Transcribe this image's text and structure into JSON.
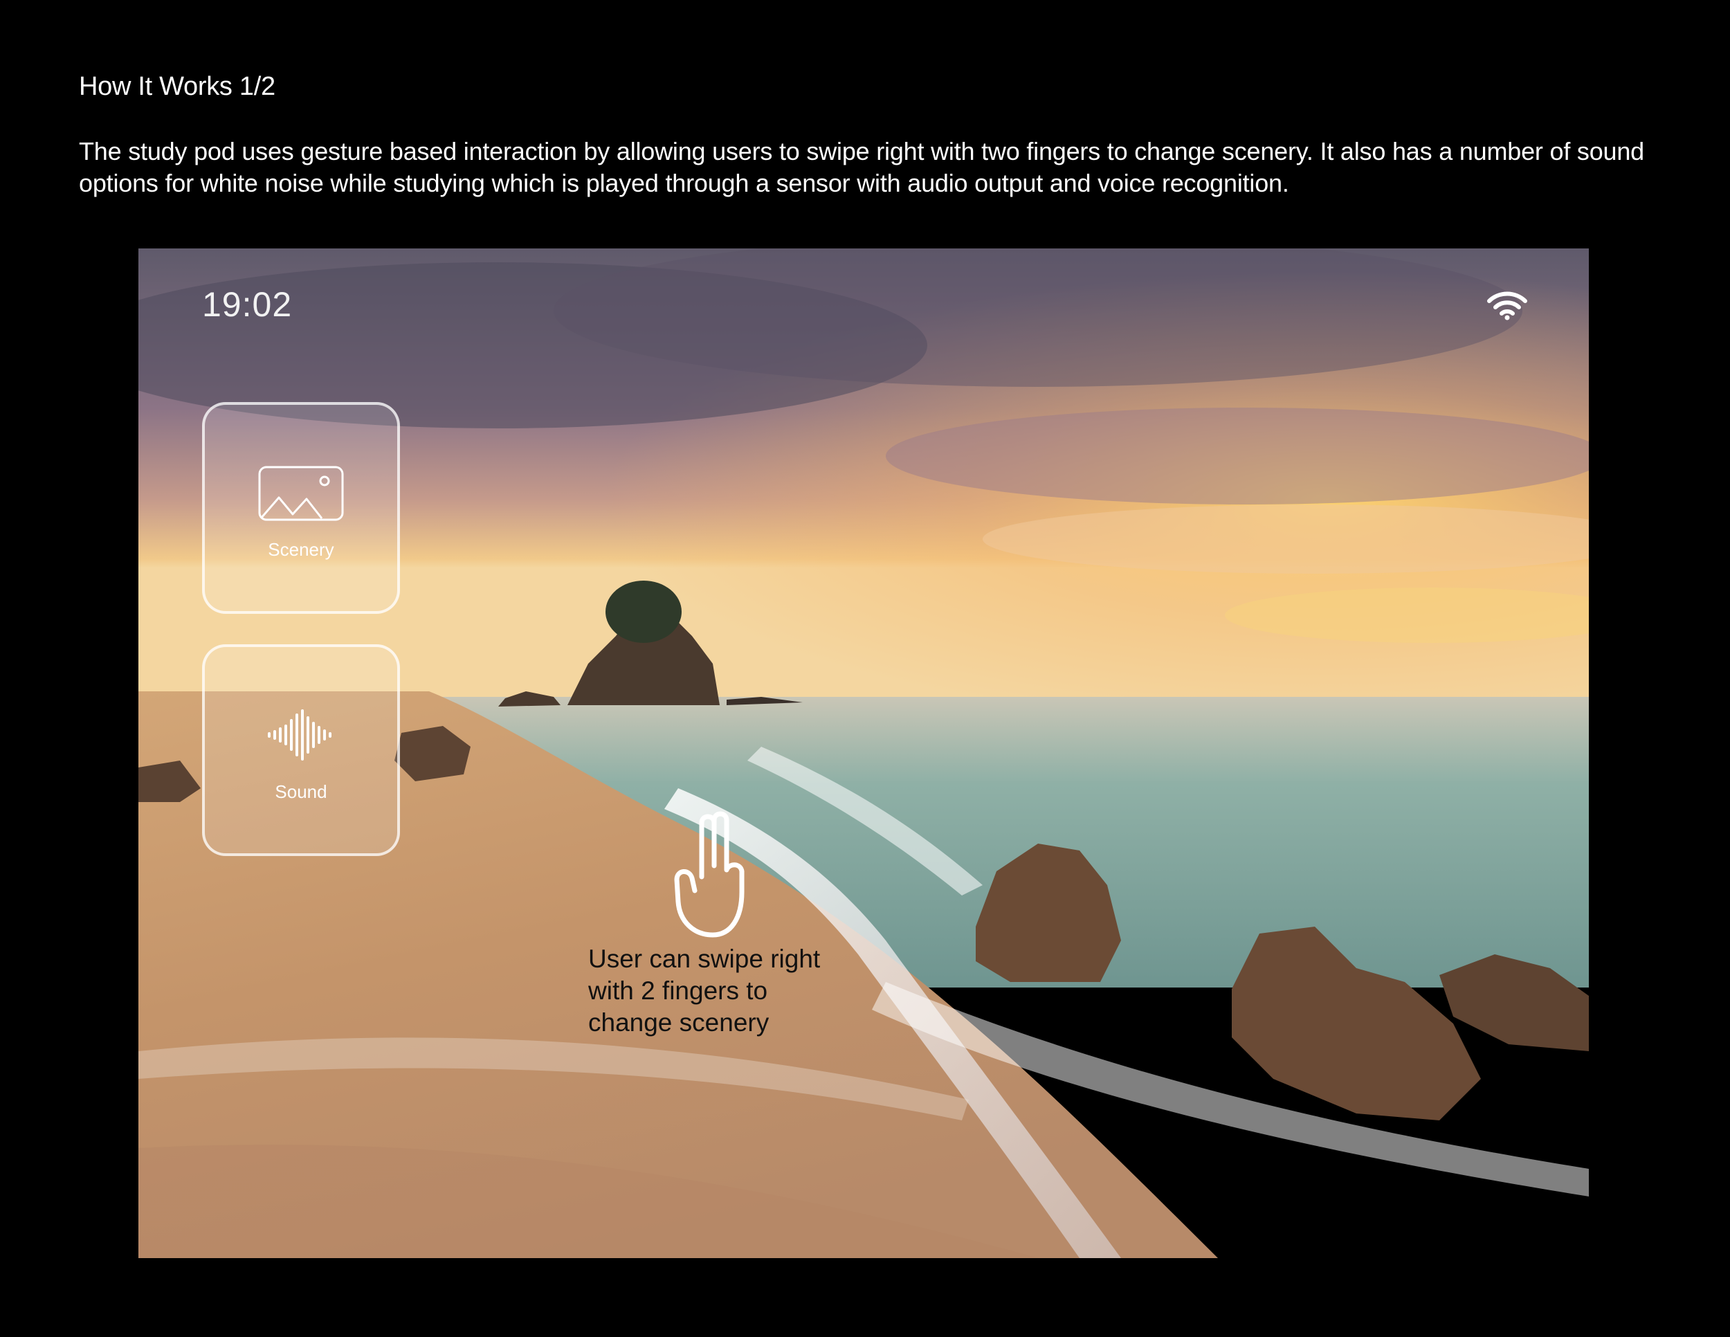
{
  "header": {
    "title": "How It Works 1/2",
    "description": "The study pod uses gesture based interaction by allowing users to swipe right with two fingers to change scenery. It also has a number of sound options for white noise while studying which is played through a sensor with audio output and voice recognition."
  },
  "screen": {
    "time": "19:02",
    "status_icons": [
      "wifi-icon"
    ],
    "tiles": [
      {
        "label": "Scenery",
        "icon": "image-icon"
      },
      {
        "label": "Sound",
        "icon": "sound-wave-icon"
      }
    ],
    "gesture": {
      "icon": "two-finger-hand-icon",
      "lines": [
        "User can swipe right",
        "with 2 fingers to",
        "change scenery"
      ]
    }
  },
  "colors": {
    "page_background": "#000000",
    "text_primary": "#ffffff",
    "gesture_text": "#111111",
    "sky_top": "#6f6577",
    "sunset_glow": "#f4c36a",
    "sea": "#86a9a0",
    "sand": "#c99a69"
  }
}
